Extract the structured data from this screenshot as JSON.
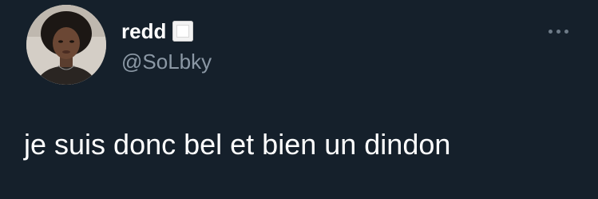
{
  "tweet": {
    "display_name": "redd",
    "name_emoji": "white-square-button",
    "handle": "@SoLbky",
    "text": "je suis donc bel et bien un dindon",
    "more_icon": "more-horizontal-icon"
  },
  "colors": {
    "background": "#15202b",
    "text_primary": "#ffffff",
    "text_secondary": "#8b98a5",
    "more_dots": "#6e7b88"
  }
}
